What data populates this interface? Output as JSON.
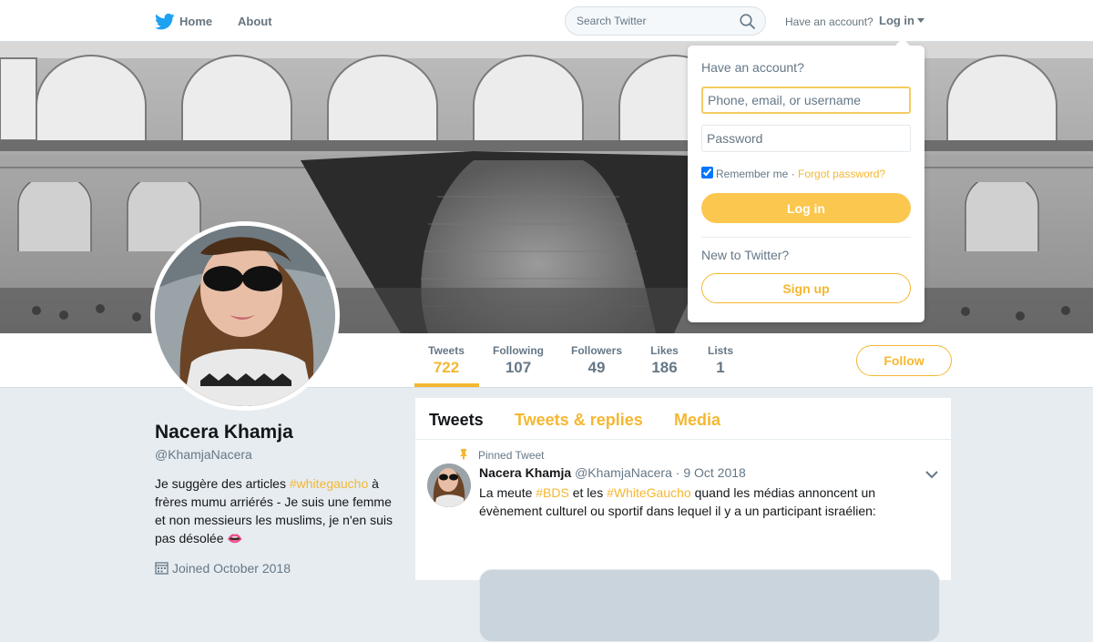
{
  "colors": {
    "accent": "#f5b731",
    "brand_bird": "#1da1f2",
    "background": "#e6ecf0"
  },
  "nav": {
    "brand_icon": "twitter-bird-icon",
    "home_label": "Home",
    "about_label": "About",
    "search_placeholder": "Search Twitter",
    "search_icon": "search-icon",
    "have_account": "Have an account?",
    "login_label": "Log in"
  },
  "profile": {
    "name": "Nacera Khamja",
    "handle": "@KhamjaNacera",
    "bio_parts": [
      "Je suggère des articles ",
      "#whitegaucho",
      " à frères mumu arriérés - Je suis une femme et non messieurs les muslims, je n'en suis pas désolée 👄"
    ],
    "joined": "Joined October 2018",
    "follow_label": "Follow"
  },
  "stats": [
    {
      "label": "Tweets",
      "value": "722",
      "active": true
    },
    {
      "label": "Following",
      "value": "107"
    },
    {
      "label": "Followers",
      "value": "49"
    },
    {
      "label": "Likes",
      "value": "186"
    },
    {
      "label": "Lists",
      "value": "1"
    }
  ],
  "timeline": {
    "tabs": [
      "Tweets",
      "Tweets & replies",
      "Media"
    ],
    "pinned_label": "Pinned Tweet",
    "tweet": {
      "name": "Nacera Khamja",
      "handle": "@KhamjaNacera",
      "separator": "·",
      "date": "9 Oct 2018",
      "text_parts": [
        "La meute ",
        "#BDS",
        " et les ",
        "#WhiteGaucho",
        " quand les médias annoncent un évènement culturel ou sportif dans lequel il y a un participant israélien:"
      ]
    }
  },
  "login_dropdown": {
    "title": "Have an account?",
    "username_placeholder": "Phone, email, or username",
    "password_placeholder": "Password",
    "remember_label": "Remember me",
    "remember_separator": "·",
    "forgot_label": "Forgot password?",
    "login_button": "Log in",
    "new_label": "New to Twitter?",
    "signup_button": "Sign up"
  }
}
